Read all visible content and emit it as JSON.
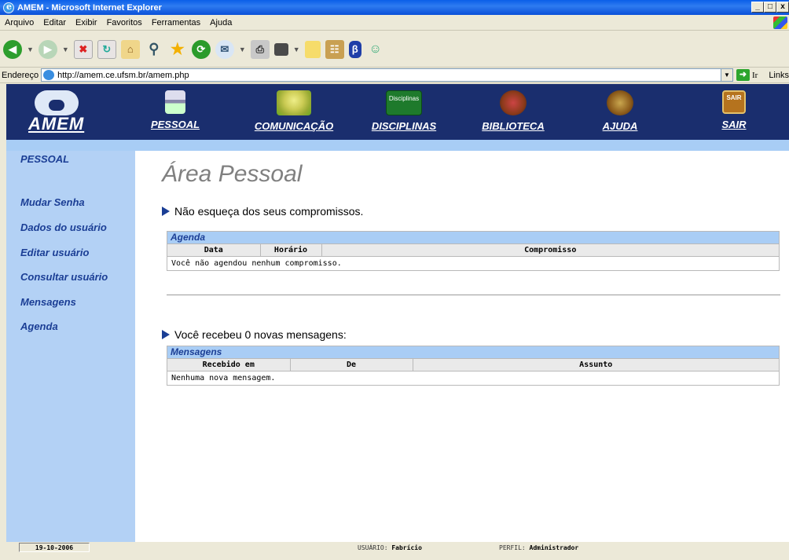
{
  "window": {
    "title": "AMEM - Microsoft Internet Explorer",
    "controls": [
      "_",
      "□",
      "x"
    ]
  },
  "menubar": {
    "items": [
      "Arquivo",
      "Editar",
      "Exibir",
      "Favoritos",
      "Ferramentas",
      "Ajuda"
    ]
  },
  "address": {
    "label": "Endereço",
    "url": "http://amem.ce.ufsm.br/amem.php",
    "go_label": "Ir",
    "links_label": "Links"
  },
  "header": {
    "logo_text": "AMEM",
    "nav": [
      {
        "label": "PESSOAL",
        "icon": "user-icon"
      },
      {
        "label": "COMUNICAÇÃO",
        "icon": "map-icon"
      },
      {
        "label": "DISCIPLINAS",
        "icon": "chalkboard-icon",
        "icon_text": "Disciplinas"
      },
      {
        "label": "BIBLIOTECA",
        "icon": "books-icon"
      },
      {
        "label": "AJUDA",
        "icon": "help-book-icon"
      },
      {
        "label": "SAIR",
        "icon": "exit-door-icon",
        "icon_text": "SAIR"
      }
    ]
  },
  "sidebar": {
    "section_title": "PESSOAL",
    "items": [
      "Mudar Senha",
      "Dados do usuário",
      "Editar usuário",
      "Consultar usuário",
      "Mensagens",
      "Agenda"
    ]
  },
  "main": {
    "title": "Área Pessoal",
    "reminder": "Não esqueça dos seus compromissos.",
    "agenda": {
      "title": "Agenda",
      "columns": [
        "Data",
        "Horário",
        "Compromisso"
      ],
      "empty": "Você não agendou nenhum compromisso."
    },
    "messages_line": "Você recebeu 0 novas mensagens:",
    "messages": {
      "title": "Mensagens",
      "columns": [
        "Recebido em",
        "De",
        "Assunto"
      ],
      "empty": "Nenhuma nova mensagem."
    }
  },
  "status": {
    "date": "19-10-2006",
    "user_label": "USUÁRIO:",
    "user": "Fabrício",
    "profile_label": "PERFIL:",
    "profile": "Administrador"
  }
}
